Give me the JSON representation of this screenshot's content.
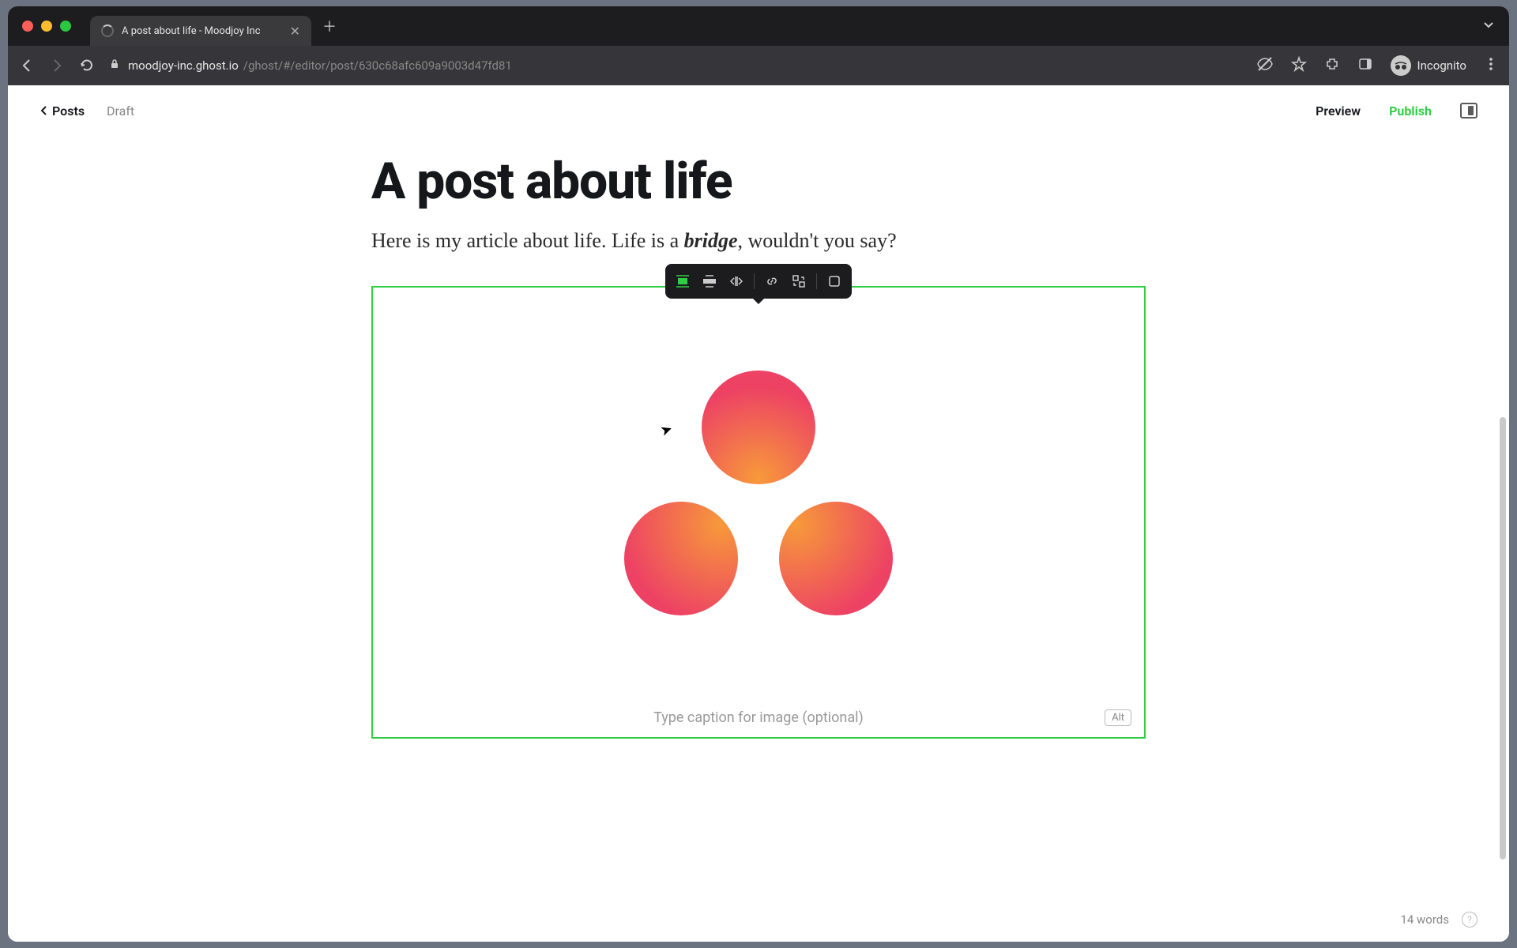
{
  "browser": {
    "tab_title": "A post about life - Moodjoy Inc",
    "url_host": "moodjoy-inc.ghost.io",
    "url_path": "/ghost/#/editor/post/630c68afc609a9003d47fd81",
    "incognito_label": "Incognito"
  },
  "editor_header": {
    "back_label": "Posts",
    "status_label": "Draft",
    "preview_label": "Preview",
    "publish_label": "Publish"
  },
  "post": {
    "title": "A post about life",
    "paragraph_before": "Here is my article about life. Life is a ",
    "bridge_word": "bridge",
    "paragraph_after": ", wouldn't you say?"
  },
  "image_card": {
    "caption_placeholder": "Type caption for image (optional)",
    "alt_label": "Alt"
  },
  "footer": {
    "word_count": "14 words"
  },
  "colors": {
    "accent_green": "#30cf43"
  }
}
